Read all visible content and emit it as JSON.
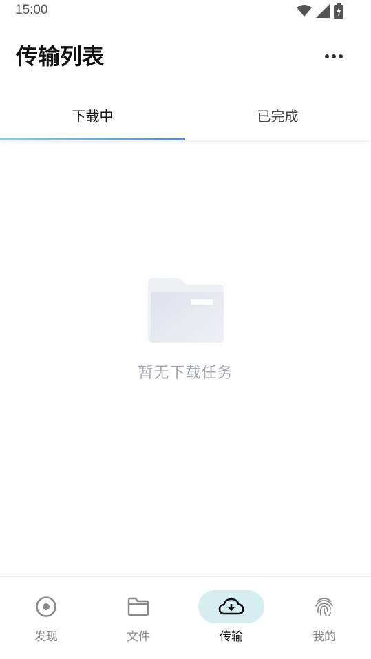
{
  "status_bar": {
    "time": "15:00",
    "icons": [
      "wifi-icon",
      "signal-icon",
      "battery-charging-icon"
    ]
  },
  "header": {
    "title": "传输列表",
    "more_icon": "more-horizontal-icon"
  },
  "tabs": [
    {
      "label": "下载中",
      "active": true
    },
    {
      "label": "已完成",
      "active": false
    }
  ],
  "empty_state": {
    "icon": "empty-folder-icon",
    "message": "暂无下载任务"
  },
  "bottom_nav": {
    "items": [
      {
        "label": "发现",
        "icon": "discover-icon",
        "active": false
      },
      {
        "label": "文件",
        "icon": "folder-icon",
        "active": false
      },
      {
        "label": "传输",
        "icon": "cloud-download-icon",
        "active": true
      },
      {
        "label": "我的",
        "icon": "fingerprint-icon",
        "active": false
      }
    ]
  },
  "colors": {
    "accent_gradient_start": "#7fd3df",
    "accent_gradient_end": "#4d8ae8",
    "active_nav_bg": "#d6eef0",
    "empty_text": "#a4a7ad"
  }
}
